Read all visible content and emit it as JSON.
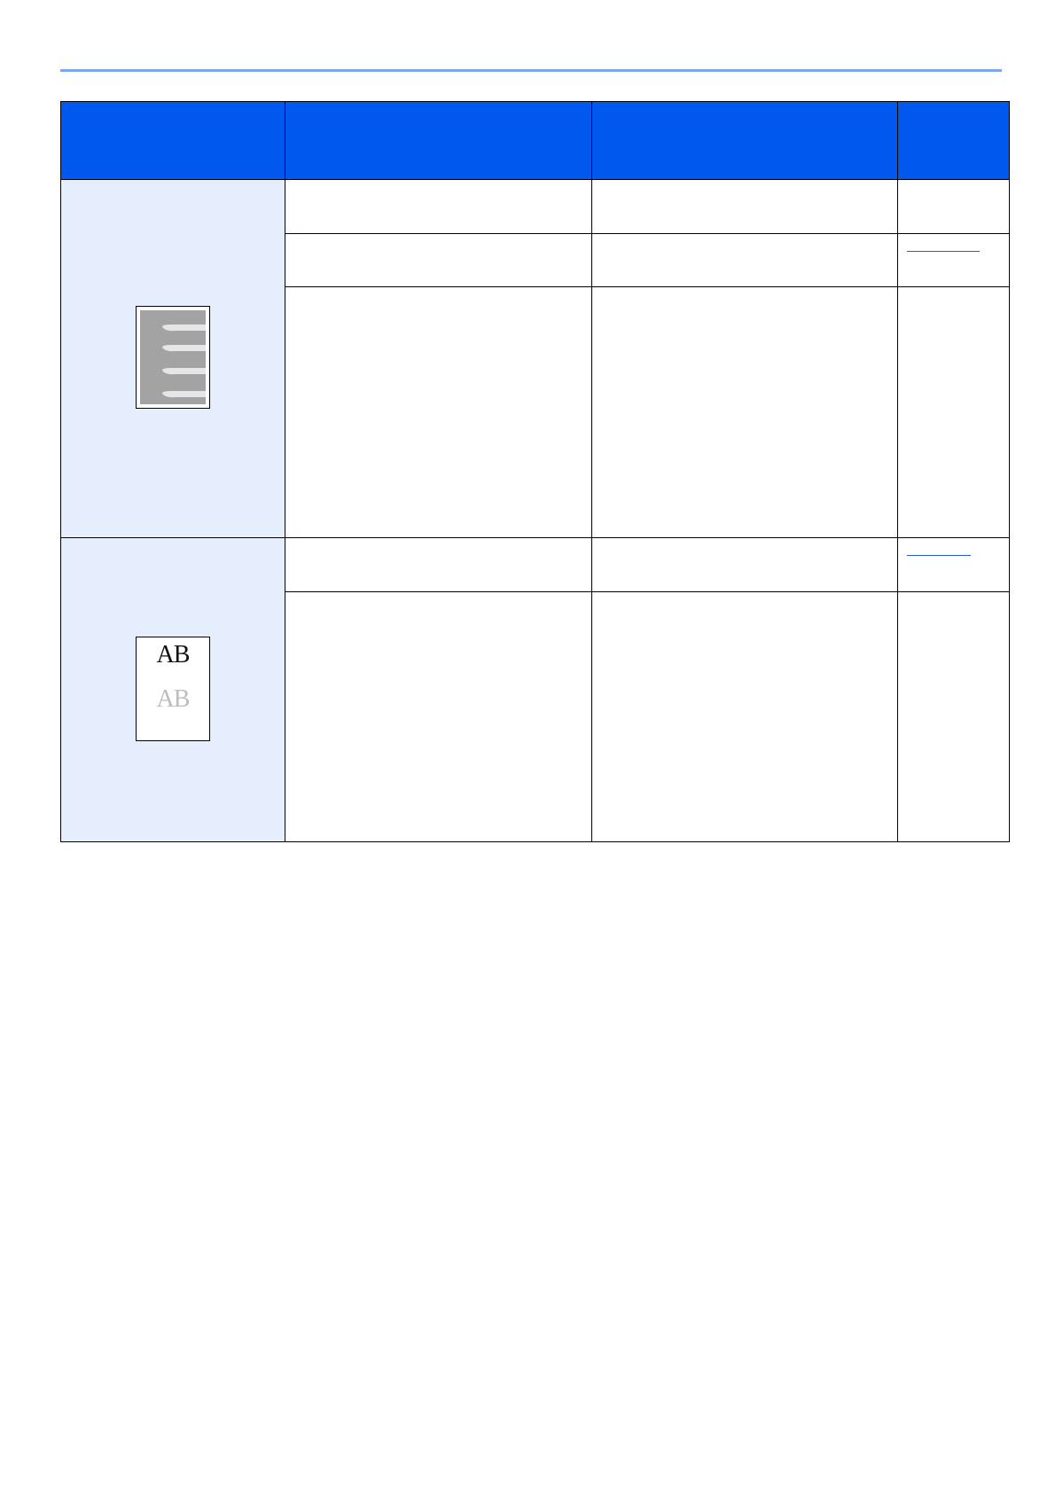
{
  "page": {
    "accent_rule_color": "#7ba7f0",
    "header_color": "#0058ef",
    "symptom_bg_color": "#e6edfc"
  },
  "table": {
    "columns": [
      "",
      "",
      "",
      ""
    ],
    "groups": [
      {
        "symptom_icon": "dirty-streaks-page-icon",
        "rows": [
          {
            "checkpoint": "",
            "action": "",
            "reference": "",
            "reference_link": false
          },
          {
            "checkpoint": "",
            "action": "",
            "reference": "",
            "reference_link": true
          },
          {
            "checkpoint": "",
            "action": "",
            "reference": "",
            "reference_link": false
          }
        ]
      },
      {
        "symptom_icon": "faint-ghost-image-page-icon",
        "thumb_text_dark": "AB",
        "thumb_text_light": "AB",
        "rows": [
          {
            "checkpoint": "",
            "action": "",
            "reference": "",
            "reference_link": true
          },
          {
            "checkpoint": "",
            "action": "",
            "reference": "",
            "reference_link": false
          }
        ]
      }
    ]
  }
}
